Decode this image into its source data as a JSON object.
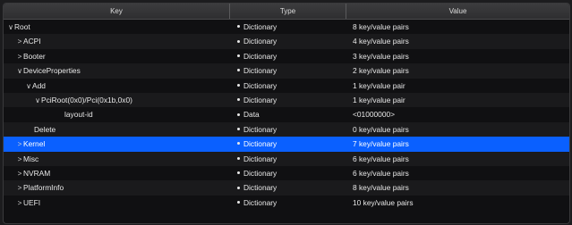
{
  "headers": {
    "key": "Key",
    "type": "Type",
    "value": "Value"
  },
  "rows": [
    {
      "chevron": "∨",
      "key": "Root",
      "type": "Dictionary",
      "value": "8 key/value pairs"
    },
    {
      "chevron": ">",
      "key": "ACPI",
      "type": "Dictionary",
      "value": "4 key/value pairs"
    },
    {
      "chevron": ">",
      "key": "Booter",
      "type": "Dictionary",
      "value": "3 key/value pairs"
    },
    {
      "chevron": "∨",
      "key": "DeviceProperties",
      "type": "Dictionary",
      "value": "2 key/value pairs"
    },
    {
      "chevron": "∨",
      "key": "Add",
      "type": "Dictionary",
      "value": "1 key/value pair"
    },
    {
      "chevron": "∨",
      "key": "PciRoot(0x0)/Pci(0x1b,0x0)",
      "type": "Dictionary",
      "value": "1 key/value pair"
    },
    {
      "chevron": "",
      "key": "layout-id",
      "type": "Data",
      "value": "<01000000>"
    },
    {
      "chevron": "",
      "key": "Delete",
      "type": "Dictionary",
      "value": "0 key/value pairs"
    },
    {
      "chevron": ">",
      "key": "Kernel",
      "type": "Dictionary",
      "value": "7 key/value pairs",
      "selected": true
    },
    {
      "chevron": ">",
      "key": "Misc",
      "type": "Dictionary",
      "value": "6 key/value pairs"
    },
    {
      "chevron": ">",
      "key": "NVRAM",
      "type": "Dictionary",
      "value": "6 key/value pairs"
    },
    {
      "chevron": ">",
      "key": "PlatformInfo",
      "type": "Dictionary",
      "value": "8 key/value pairs"
    },
    {
      "chevron": ">",
      "key": "UEFI",
      "type": "Dictionary",
      "value": "10 key/value pairs"
    }
  ],
  "colors": {
    "selection": "#0a60ff",
    "background": "#101012"
  }
}
